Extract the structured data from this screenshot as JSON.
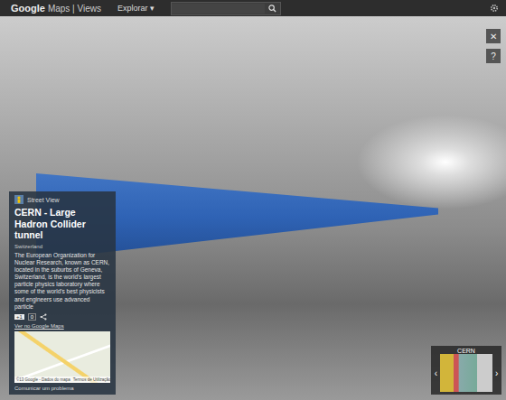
{
  "header": {
    "logo": "Google",
    "product": "Maps | Views",
    "menu": "Explorar ▾"
  },
  "viewer": {
    "close": "✕",
    "help": "?"
  },
  "info_card": {
    "badge": "Street View",
    "title": "CERN - Large Hadron Collider tunnel",
    "subtitle": "Switzerland",
    "description": "The European Organization for Nuclear Research, known as CERN, located in the suburbs of Geneva, Switzerland, is the world's largest particle physics laboratory where some of the world's best physicists and engineers use advanced particle",
    "plus_one": "+1",
    "count": "0",
    "map_link": "Ver no Google Maps",
    "map_attribution": "©13 Google - Dados do mapa",
    "map_terms": "Termos de Utilização",
    "report": "Comunicar um problema"
  },
  "thumbnail": {
    "label": "CERN",
    "prev": "‹",
    "next": "›"
  }
}
